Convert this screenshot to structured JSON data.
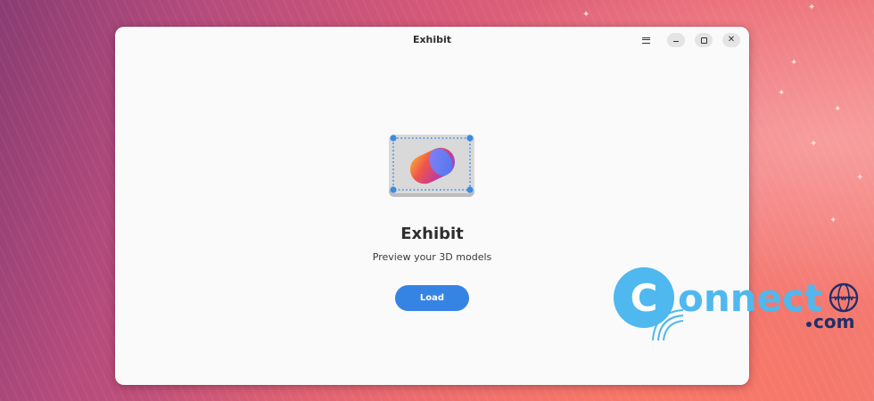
{
  "window": {
    "title": "Exhibit"
  },
  "titlebar": {
    "menu_icon": "hamburger-menu-icon",
    "minimize_icon": "minimize-icon",
    "maximize_icon": "maximize-icon",
    "close_icon": "close-icon",
    "close_glyph": "✕"
  },
  "main": {
    "app_icon": "exhibit-app-icon",
    "app_name": "Exhibit",
    "subtitle": "Preview your 3D models",
    "load_label": "Load"
  },
  "watermark": {
    "brand_main": "onnect",
    "brand_c": "C",
    "domain_suffix": "com",
    "globe_text": "www"
  },
  "colors": {
    "accent": "#3584e4",
    "window_bg": "#fafafa",
    "watermark_blue": "#4fb8ef"
  }
}
